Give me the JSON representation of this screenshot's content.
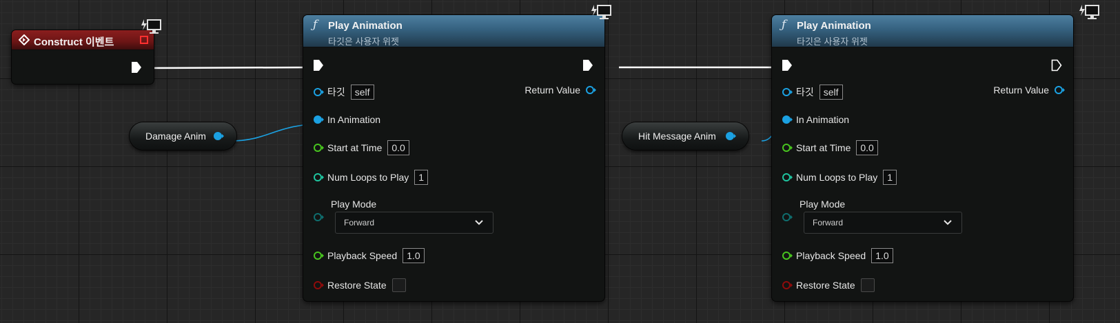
{
  "construct_node": {
    "title": "Construct 이벤트"
  },
  "variables": [
    {
      "label": "Damage Anim"
    },
    {
      "label": "Hit Message Anim"
    }
  ],
  "play_nodes": [
    {
      "title": "Play Animation",
      "subtitle": "타깃은 사용자 위젯",
      "return_label": "Return Value",
      "target_label": "타깃",
      "target_value": "self",
      "in_animation_label": "In Animation",
      "start_time_label": "Start at Time",
      "start_time_value": "0.0",
      "num_loops_label": "Num Loops to Play",
      "num_loops_value": "1",
      "play_mode_label": "Play Mode",
      "play_mode_value": "Forward",
      "playback_speed_label": "Playback Speed",
      "playback_speed_value": "1.0",
      "restore_state_label": "Restore State",
      "restore_state_checked": false,
      "exec_out_connected": true
    },
    {
      "title": "Play Animation",
      "subtitle": "타깃은 사용자 위젯",
      "return_label": "Return Value",
      "target_label": "타깃",
      "target_value": "self",
      "in_animation_label": "In Animation",
      "start_time_label": "Start at Time",
      "start_time_value": "0.0",
      "num_loops_label": "Num Loops to Play",
      "num_loops_value": "1",
      "play_mode_label": "Play Mode",
      "play_mode_value": "Forward",
      "playback_speed_label": "Playback Speed",
      "playback_speed_value": "1.0",
      "restore_state_label": "Restore State",
      "restore_state_checked": false,
      "exec_out_connected": false
    }
  ],
  "colors": {
    "exec_wire": "#ffffff",
    "object_pin": "#1ba1e2",
    "float_pin": "#48c51f",
    "int_pin": "#1fc5a0",
    "enum_pin": "#0f6e6e",
    "bool_pin": "#8f0b0b",
    "event_header": "#8b1e1e",
    "function_header": "#35617f"
  },
  "icons": {
    "function": "function-icon",
    "event": "event-diamond-icon",
    "screen": "monitor-lightning-icon",
    "dropdown": "chevron-down-icon"
  }
}
